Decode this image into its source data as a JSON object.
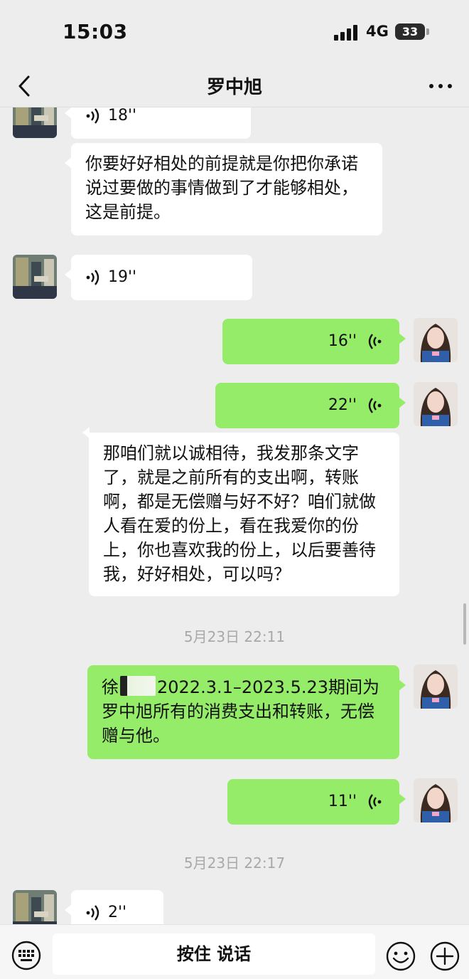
{
  "status_bar": {
    "time": "15:03",
    "network": "4G",
    "battery": "33"
  },
  "nav": {
    "title": "罗中旭",
    "back_icon": "chevron-left-icon",
    "more_icon": "more-dots-icon"
  },
  "messages": [
    {
      "direction": "incoming",
      "type": "voice",
      "duration": "18''"
    },
    {
      "direction": "incoming",
      "type": "text",
      "text": "你要好好相处的前提就是你把你承诺说过要做的事情做到了才能够相处，这是前提。"
    },
    {
      "direction": "incoming",
      "type": "voice",
      "duration": "19''"
    },
    {
      "direction": "outgoing",
      "type": "voice",
      "duration": "16''"
    },
    {
      "direction": "outgoing",
      "type": "voice",
      "duration": "22''"
    },
    {
      "direction": "incoming",
      "type": "text",
      "text": "那咱们就以诚相待，我发那条文字了，就是之前所有的支出啊，转账啊，都是无偿赠与好不好？咱们就做人看在爱的份上，看在我爱你的份上，你也喜欢我的份上，以后要善待我，好好相处，可以吗？"
    },
    {
      "type": "timestamp",
      "text": "5月23日 22:11"
    },
    {
      "direction": "outgoing",
      "type": "text",
      "prefix": "徐",
      "text": "2022.3.1–2023.5.23期间为罗中旭所有的消费支出和转账，无偿赠与他。"
    },
    {
      "direction": "outgoing",
      "type": "voice",
      "duration": "11''"
    },
    {
      "type": "timestamp",
      "text": "5月23日 22:17"
    },
    {
      "direction": "incoming",
      "type": "voice",
      "duration": "2''"
    }
  ],
  "input_bar": {
    "hold_to_talk": "按住 说话",
    "keyboard_icon": "keyboard-icon",
    "emoji_icon": "emoji-icon",
    "plus_icon": "plus-icon"
  },
  "colors": {
    "outgoing_bubble": "#95ec69",
    "incoming_bubble": "#ffffff",
    "background": "#ededed"
  }
}
